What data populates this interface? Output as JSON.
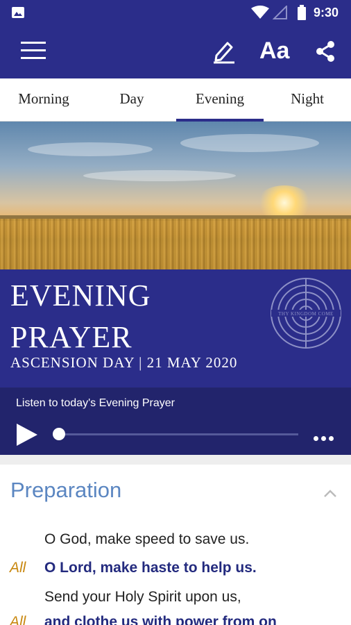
{
  "status_bar": {
    "time": "9:30",
    "icons": [
      "image-icon",
      "wifi-icon",
      "signal-icon",
      "battery-icon"
    ]
  },
  "app_bar": {
    "icons": [
      "menu-icon",
      "edit-icon",
      "font-size-icon",
      "share-icon"
    ],
    "font_label": "Aa"
  },
  "tabs": [
    {
      "label": "Morning",
      "active": false
    },
    {
      "label": "Day",
      "active": false
    },
    {
      "label": "Evening",
      "active": true
    },
    {
      "label": "Night",
      "active": false
    }
  ],
  "banner": {
    "title_line1": "EVENING",
    "title_line2": "PRAYER",
    "subtitle": "ASCENSION DAY | 21 MAY 2020",
    "logo_text": "THY KINGDOM COME"
  },
  "player": {
    "caption": "Listen to today's Evening Prayer",
    "progress": 0
  },
  "section": {
    "title": "Preparation",
    "lines": [
      {
        "speaker": "",
        "text": "O God, make speed to save us.",
        "bold": false
      },
      {
        "speaker": "All",
        "text": "O Lord, make haste to help us.",
        "bold": true
      },
      {
        "speaker": "",
        "text": "Send your Holy Spirit upon us,",
        "bold": false
      },
      {
        "speaker": "All",
        "text": "and clothe us with power from on",
        "bold": true
      }
    ]
  },
  "colors": {
    "primary": "#2b2d8a",
    "player_bg": "#22246c",
    "accent_blue": "#5b86c1",
    "all_label": "#c8870e"
  }
}
